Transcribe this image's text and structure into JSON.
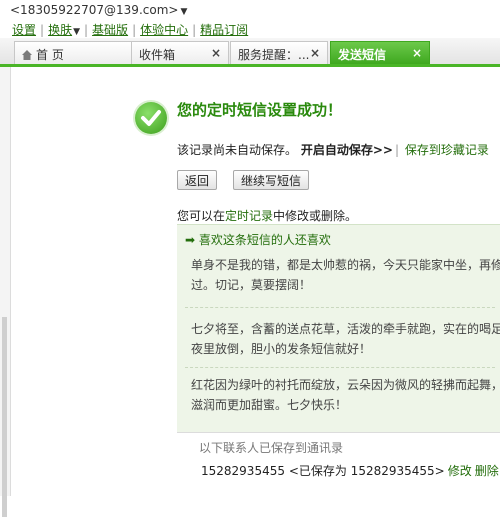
{
  "header": {
    "account": "<18305922707@139.com>",
    "menu": {
      "settings": "设置",
      "skin": "换肤",
      "basic": "基础版",
      "experience": "体验中心",
      "subscribe": "精品订阅"
    }
  },
  "tabs": [
    {
      "label": "首 页"
    },
    {
      "label": "收件箱"
    },
    {
      "label": "服务提醒：..."
    },
    {
      "label": "发送短信"
    }
  ],
  "main": {
    "title": "您的定时短信设置成功！",
    "not_saved": "该记录尚未自动保存。",
    "auto_save_link": "开启自动保存>>",
    "save_collection_link": "保存到珍藏记录",
    "back_button": "返回",
    "continue_button": "继续写短信",
    "hint_prefix": "您可以在",
    "hint_link": "定时记录",
    "hint_suffix": "中修改或删除。"
  },
  "recommend": {
    "header": "➡ 喜欢这条短信的人还喜欢",
    "messages": [
      {
        "line1": "单身不是我的错，都是太帅惹的祸，今天只能家中坐，再修都没有",
        "line2": "过。切记，莫要摆阔！"
      },
      {
        "line1": "七夕将至，含蓄的送点花草，活泼的牵手就跑，实在的喝足吃饱，",
        "line2": "夜里放倒，胆小的发条短信就好！"
      },
      {
        "line1": "红花因为绿叶的衬托而绽放，云朵因为微风的轻拂而起舞，鱼儿因",
        "line2": "滋润而更加甜蜜。七夕快乐！"
      }
    ]
  },
  "saved_contacts": {
    "note": "以下联系人已保存到通讯录",
    "number": "15282935455",
    "saved_as": "<已保存为 15282935455>",
    "edit": "修改",
    "delete": "删除"
  },
  "colors": {
    "accent": "#3fa81f",
    "link": "#246e0c",
    "title": "#2a8a0d"
  }
}
